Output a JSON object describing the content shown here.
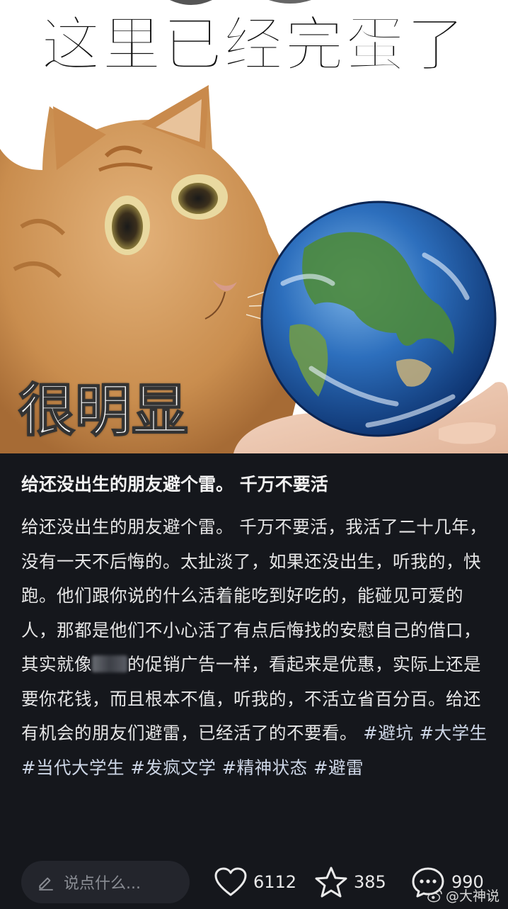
{
  "meme": {
    "top_caption": "这里已经完蛋了",
    "bottom_caption": "很明显"
  },
  "post": {
    "title": "给还没出生的朋友避个雷。 千万不要活",
    "body_part1": "给还没出生的朋友避个雷。 千万不要活，我活了二十几年，没有一天不后悔的。太扯淡了，如果还没出生，听我的，快跑。他们跟你说的什么活着能吃到好吃的，能碰见可爱的人，那都是他们不小心活了有点后悔找的安慰自己的借口，其实就像",
    "body_part2": "的促销广告一样，看起来是优惠，实际上还是要你花钱，而且根本不值，听我的，不活立省百分百。给还有机会的朋友们避雷，已经活了的不要看。",
    "tags": [
      "#避坑",
      "#大学生",
      "#当代大学生",
      "#发疯文学",
      "#精神状态",
      "#避雷"
    ]
  },
  "actions": {
    "comment_placeholder": "说点什么...",
    "likes": "6112",
    "favorites": "385",
    "comments": "990"
  },
  "watermark": "@大神说",
  "colors": {
    "background": "#15171c",
    "text": "#e6e6e6",
    "input_bg": "#23252c"
  }
}
